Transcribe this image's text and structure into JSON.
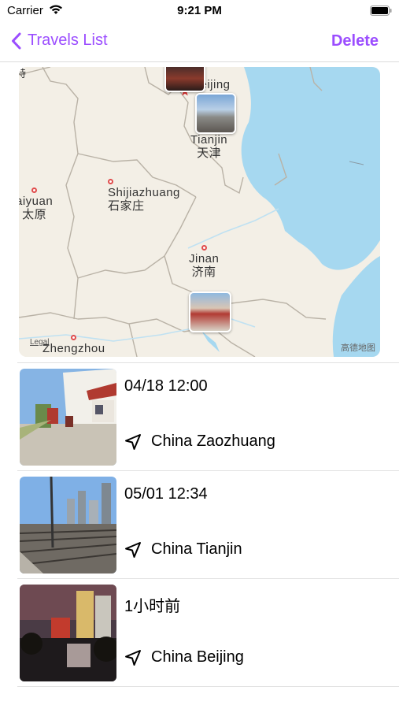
{
  "status_bar": {
    "carrier": "Carrier",
    "time": "9:21 PM"
  },
  "nav": {
    "back_label": "Travels List",
    "delete_label": "Delete"
  },
  "map": {
    "cities": [
      {
        "name": "Beijing",
        "name_zh": ""
      },
      {
        "name": "Tianjin",
        "name_zh": "天津"
      },
      {
        "name": "Shijiazhuang",
        "name_zh": "石家庄"
      },
      {
        "name": "aiyuan",
        "name_zh": "太原"
      },
      {
        "name": "Jinan",
        "name_zh": "济南"
      },
      {
        "name": "Zhengzhou",
        "name_zh": ""
      }
    ],
    "legal": "Legal",
    "provider": "高德地图",
    "edge_label": "特",
    "sea_color": "#a6d8f0",
    "land_color": "#f3efe6"
  },
  "travels": [
    {
      "date": "04/18 12:00",
      "location": "China Zaozhuang"
    },
    {
      "date": "05/01 12:34",
      "location": "China Tianjin"
    },
    {
      "date": "1小时前",
      "location": "China Beijing"
    }
  ],
  "colors": {
    "accent": "#9b4dff"
  }
}
